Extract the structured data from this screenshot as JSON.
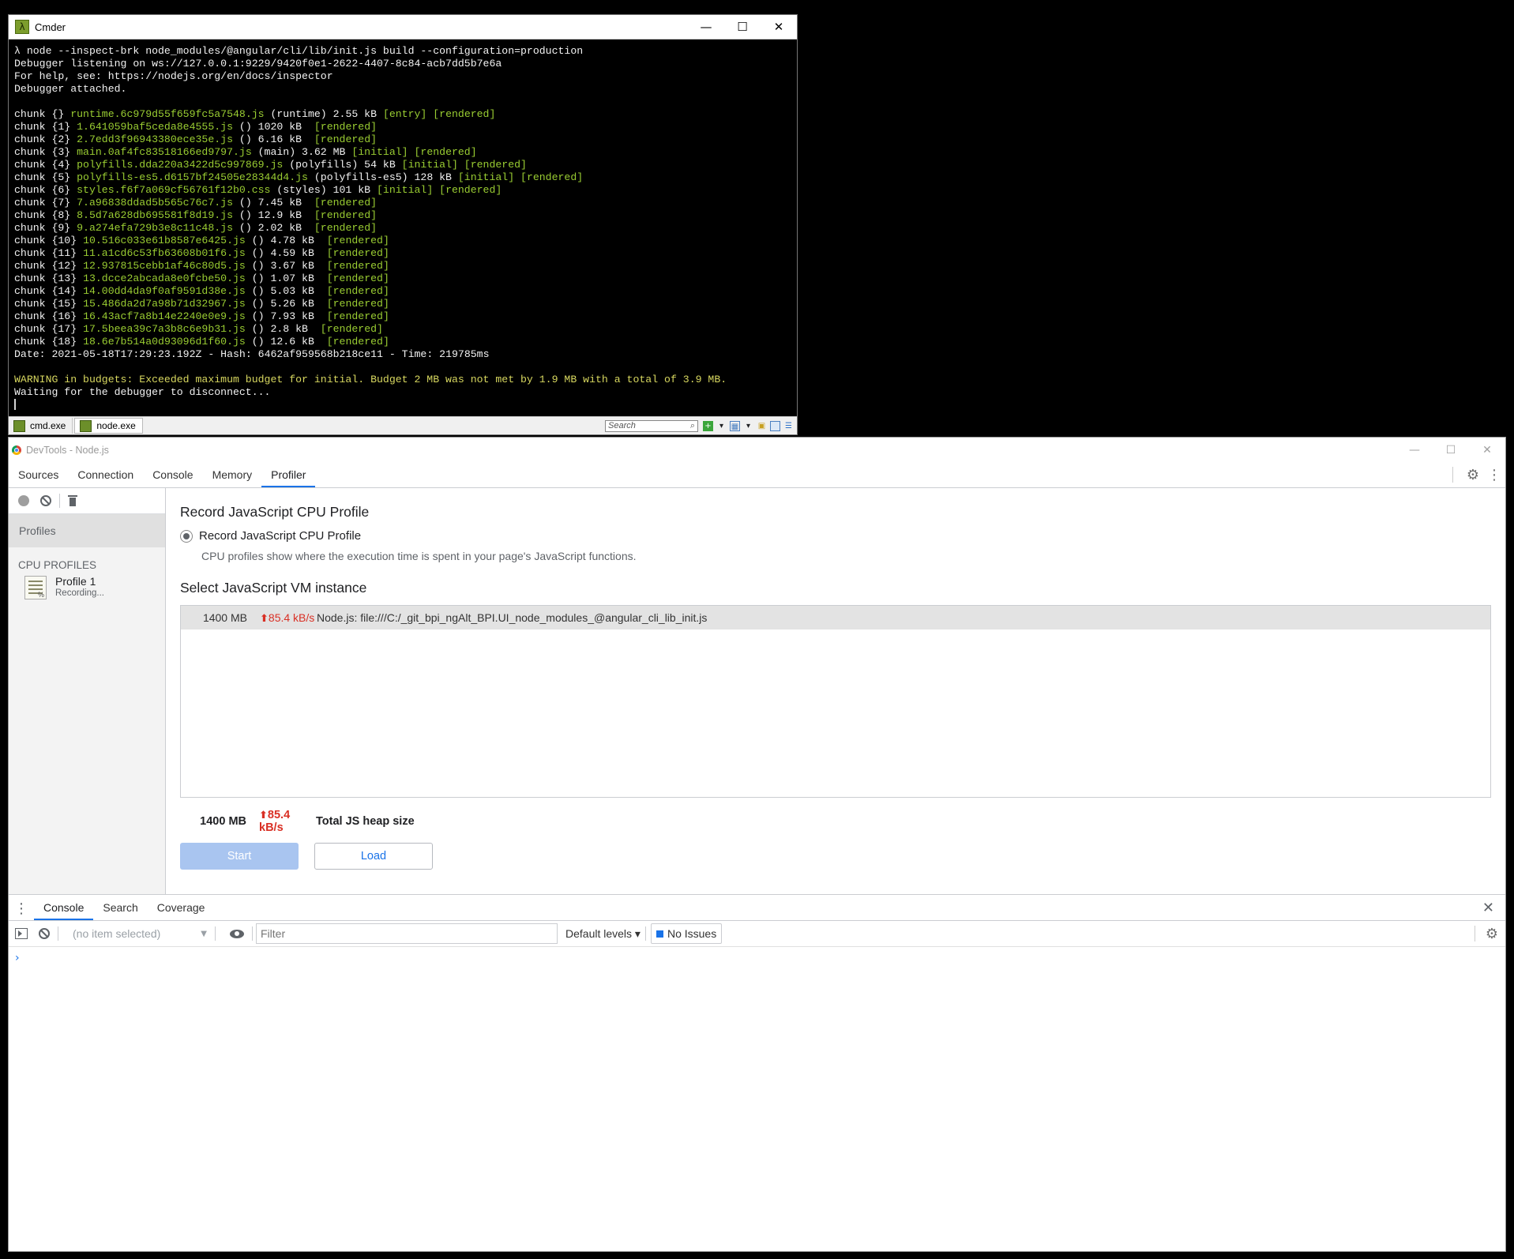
{
  "cmder": {
    "title": "Cmder",
    "lines": [
      [
        {
          "t": "λ node --inspect-brk node_modules/@angular/cli/lib/init.js build --configuration=production",
          "c": "c-white"
        }
      ],
      [
        {
          "t": "Debugger listening on ws://127.0.0.1:9229/9420f0e1-2622-4407-8c84-acb7dd5b7e6a",
          "c": "c-white"
        }
      ],
      [
        {
          "t": "For help, see: https://nodejs.org/en/docs/inspector",
          "c": "c-white"
        }
      ],
      [
        {
          "t": "Debugger attached.",
          "c": "c-white"
        }
      ],
      [
        {
          "t": "",
          "c": ""
        }
      ],
      [
        {
          "t": "chunk {} ",
          "c": "c-white"
        },
        {
          "t": "runtime.6c979d55f659fc5a7548.js",
          "c": "c-green"
        },
        {
          "t": " (runtime) 2.55 kB ",
          "c": "c-white"
        },
        {
          "t": "[entry] [rendered]",
          "c": "c-green"
        }
      ],
      [
        {
          "t": "chunk {1} ",
          "c": "c-white"
        },
        {
          "t": "1.641059baf5ceda8e4555.js",
          "c": "c-green"
        },
        {
          "t": " () 1020 kB  ",
          "c": "c-white"
        },
        {
          "t": "[rendered]",
          "c": "c-green"
        }
      ],
      [
        {
          "t": "chunk {2} ",
          "c": "c-white"
        },
        {
          "t": "2.7edd3f96943380ece35e.js",
          "c": "c-green"
        },
        {
          "t": " () 6.16 kB  ",
          "c": "c-white"
        },
        {
          "t": "[rendered]",
          "c": "c-green"
        }
      ],
      [
        {
          "t": "chunk {3} ",
          "c": "c-white"
        },
        {
          "t": "main.0af4fc83518166ed9797.js",
          "c": "c-green"
        },
        {
          "t": " (main) 3.62 MB ",
          "c": "c-white"
        },
        {
          "t": "[initial] [rendered]",
          "c": "c-green"
        }
      ],
      [
        {
          "t": "chunk {4} ",
          "c": "c-white"
        },
        {
          "t": "polyfills.dda220a3422d5c997869.js",
          "c": "c-green"
        },
        {
          "t": " (polyfills) 54 kB ",
          "c": "c-white"
        },
        {
          "t": "[initial] [rendered]",
          "c": "c-green"
        }
      ],
      [
        {
          "t": "chunk {5} ",
          "c": "c-white"
        },
        {
          "t": "polyfills-es5.d6157bf24505e28344d4.js",
          "c": "c-green"
        },
        {
          "t": " (polyfills-es5) 128 kB ",
          "c": "c-white"
        },
        {
          "t": "[initial] [rendered]",
          "c": "c-green"
        }
      ],
      [
        {
          "t": "chunk {6} ",
          "c": "c-white"
        },
        {
          "t": "styles.f6f7a069cf56761f12b0.css",
          "c": "c-green"
        },
        {
          "t": " (styles) 101 kB ",
          "c": "c-white"
        },
        {
          "t": "[initial] [rendered]",
          "c": "c-green"
        }
      ],
      [
        {
          "t": "chunk {7} ",
          "c": "c-white"
        },
        {
          "t": "7.a96838ddad5b565c76c7.js",
          "c": "c-green"
        },
        {
          "t": " () 7.45 kB  ",
          "c": "c-white"
        },
        {
          "t": "[rendered]",
          "c": "c-green"
        }
      ],
      [
        {
          "t": "chunk {8} ",
          "c": "c-white"
        },
        {
          "t": "8.5d7a628db695581f8d19.js",
          "c": "c-green"
        },
        {
          "t": " () 12.9 kB  ",
          "c": "c-white"
        },
        {
          "t": "[rendered]",
          "c": "c-green"
        }
      ],
      [
        {
          "t": "chunk {9} ",
          "c": "c-white"
        },
        {
          "t": "9.a274efa729b3e8c11c48.js",
          "c": "c-green"
        },
        {
          "t": " () 2.02 kB  ",
          "c": "c-white"
        },
        {
          "t": "[rendered]",
          "c": "c-green"
        }
      ],
      [
        {
          "t": "chunk {10} ",
          "c": "c-white"
        },
        {
          "t": "10.516c033e61b8587e6425.js",
          "c": "c-green"
        },
        {
          "t": " () 4.78 kB  ",
          "c": "c-white"
        },
        {
          "t": "[rendered]",
          "c": "c-green"
        }
      ],
      [
        {
          "t": "chunk {11} ",
          "c": "c-white"
        },
        {
          "t": "11.a1cd6c53fb63608b01f6.js",
          "c": "c-green"
        },
        {
          "t": " () 4.59 kB  ",
          "c": "c-white"
        },
        {
          "t": "[rendered]",
          "c": "c-green"
        }
      ],
      [
        {
          "t": "chunk {12} ",
          "c": "c-white"
        },
        {
          "t": "12.937815cebb1af46c80d5.js",
          "c": "c-green"
        },
        {
          "t": " () 3.67 kB  ",
          "c": "c-white"
        },
        {
          "t": "[rendered]",
          "c": "c-green"
        }
      ],
      [
        {
          "t": "chunk {13} ",
          "c": "c-white"
        },
        {
          "t": "13.dcce2abcada8e0fcbe50.js",
          "c": "c-green"
        },
        {
          "t": " () 1.07 kB  ",
          "c": "c-white"
        },
        {
          "t": "[rendered]",
          "c": "c-green"
        }
      ],
      [
        {
          "t": "chunk {14} ",
          "c": "c-white"
        },
        {
          "t": "14.00dd4da9f0af9591d38e.js",
          "c": "c-green"
        },
        {
          "t": " () 5.03 kB  ",
          "c": "c-white"
        },
        {
          "t": "[rendered]",
          "c": "c-green"
        }
      ],
      [
        {
          "t": "chunk {15} ",
          "c": "c-white"
        },
        {
          "t": "15.486da2d7a98b71d32967.js",
          "c": "c-green"
        },
        {
          "t": " () 5.26 kB  ",
          "c": "c-white"
        },
        {
          "t": "[rendered]",
          "c": "c-green"
        }
      ],
      [
        {
          "t": "chunk {16} ",
          "c": "c-white"
        },
        {
          "t": "16.43acf7a8b14e2240e0e9.js",
          "c": "c-green"
        },
        {
          "t": " () 7.93 kB  ",
          "c": "c-white"
        },
        {
          "t": "[rendered]",
          "c": "c-green"
        }
      ],
      [
        {
          "t": "chunk {17} ",
          "c": "c-white"
        },
        {
          "t": "17.5beea39c7a3b8c6e9b31.js",
          "c": "c-green"
        },
        {
          "t": " () 2.8 kB  ",
          "c": "c-white"
        },
        {
          "t": "[rendered]",
          "c": "c-green"
        }
      ],
      [
        {
          "t": "chunk {18} ",
          "c": "c-white"
        },
        {
          "t": "18.6e7b514a0d93096d1f60.js",
          "c": "c-green"
        },
        {
          "t": " () 12.6 kB  ",
          "c": "c-white"
        },
        {
          "t": "[rendered]",
          "c": "c-green"
        }
      ],
      [
        {
          "t": "Date: ",
          "c": "c-white"
        },
        {
          "t": "2021-05-18T17:29:23.192Z",
          "c": "c-white"
        },
        {
          "t": " - Hash: ",
          "c": "c-white"
        },
        {
          "t": "6462af959568b218ce11",
          "c": "c-white"
        },
        {
          "t": " - Time: ",
          "c": "c-white"
        },
        {
          "t": "219785ms",
          "c": "c-white"
        }
      ],
      [
        {
          "t": "",
          "c": ""
        }
      ],
      [
        {
          "t": "WARNING in budgets: Exceeded maximum budget for initial. Budget 2 MB was not met by 1.9 MB with a total of 3.9 MB.",
          "c": "c-yellow"
        }
      ],
      [
        {
          "t": "Waiting for the debugger to disconnect...",
          "c": "c-white"
        }
      ]
    ],
    "tabs": [
      "cmd.exe",
      "node.exe"
    ],
    "search_placeholder": "Search"
  },
  "devtools": {
    "title": "DevTools - Node.js",
    "tabs": [
      "Sources",
      "Connection",
      "Console",
      "Memory",
      "Profiler"
    ],
    "active_tab": "Profiler",
    "sidebar": {
      "profiles_label": "Profiles",
      "section_label": "CPU PROFILES",
      "profile_name": "Profile 1",
      "profile_status": "Recording..."
    },
    "main": {
      "title": "Record JavaScript CPU Profile",
      "radio_label": "Record JavaScript CPU Profile",
      "radio_desc": "CPU profiles show where the execution time is spent in your page's JavaScript functions.",
      "vm_title": "Select JavaScript VM instance",
      "vm_row": {
        "size": "1400 MB",
        "rate": "85.4 kB/s",
        "name": "Node.js: file:///C:/_git_bpi_ngAlt_BPI.UI_node_modules_@angular_cli_lib_init.js"
      },
      "heap": {
        "size": "1400 MB",
        "rate": "85.4 kB/s",
        "label": "Total JS heap size"
      },
      "start_label": "Start",
      "load_label": "Load"
    },
    "drawer": {
      "tabs": [
        "Console",
        "Search",
        "Coverage"
      ],
      "context": "(no item selected)",
      "filter_placeholder": "Filter",
      "levels": "Default levels ▾",
      "issues": "No Issues"
    }
  }
}
